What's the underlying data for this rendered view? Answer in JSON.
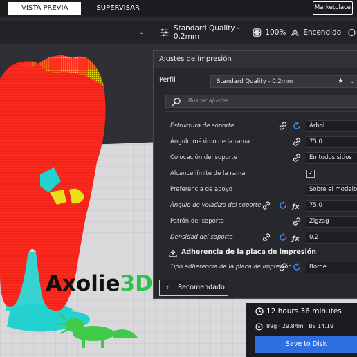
{
  "tabs": {
    "preview": "VISTA PREVIA",
    "monitor": "SUPERVISAR",
    "marketplace": "Marketplace"
  },
  "toolbar": {
    "profile_summary": "Standard Quality - 0.2mm",
    "infill": "100%",
    "support": "Encendido"
  },
  "settings_panel": {
    "title": "Ajustes de impresión",
    "profile_label": "Perfil",
    "profile_value": "Standard Quality - 0.2mm",
    "search_placeholder": "Buscar ajustes",
    "rows": [
      {
        "label": "Estructura de soporte",
        "value": "Árbol",
        "italic": true
      },
      {
        "label": "Ángulo máximo de la rama",
        "value": "75.0",
        "italic": false
      },
      {
        "label": "Colocación del soporte",
        "value": "En todos sitios",
        "italic": false
      },
      {
        "label": "Alcance límite de la rama",
        "value": "",
        "italic": false,
        "checked": true
      },
      {
        "label": "Preferencia de apoyo",
        "value": "Sobre el modelo, e.",
        "italic": false
      },
      {
        "label": "Ángulo de voladizo del soporte",
        "value": "75.0",
        "italic": true
      },
      {
        "label": "Patrón del soporte",
        "value": "Zigzag",
        "italic": false
      },
      {
        "label": "Densidad del soporte",
        "value": "0.2",
        "italic": true
      }
    ],
    "section_title": "Adherencia de la placa de impresión",
    "adhesion_label": "Tipo adherencia de la placa de impresión",
    "adhesion_value": "Borde",
    "recommended_button": "Recomendado"
  },
  "print_summary": {
    "time": "12 hours 36 minutes",
    "material": "89g · 29.84m · BS 14.19",
    "save_button": "Save to Disk"
  },
  "watermark": {
    "brand_prefix": "Axolie",
    "brand_suffix": "3D"
  },
  "colors": {
    "accent": "#2d6fe0",
    "model": "#ff2a1f",
    "support": "#23d1cf",
    "plate": "#d9d9dc"
  }
}
